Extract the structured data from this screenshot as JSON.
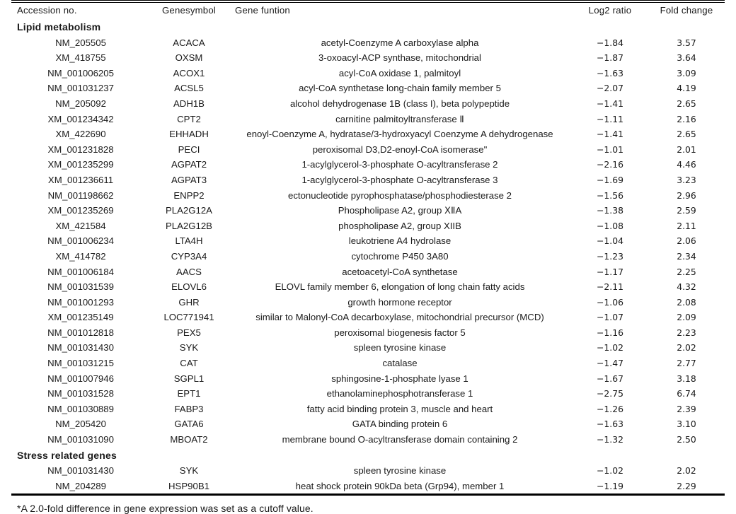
{
  "table": {
    "columns": [
      {
        "key": "accession",
        "label": "Accession no."
      },
      {
        "key": "genesymbol",
        "label": "Genesymbol"
      },
      {
        "key": "function",
        "label": "Gene funtion"
      },
      {
        "key": "log2",
        "label": "Log2 ratio"
      },
      {
        "key": "fold",
        "label": "Fold change"
      }
    ],
    "sections": [
      {
        "title": "Lipid metabolism",
        "rows": [
          {
            "accession": "NM_205505",
            "genesymbol": "ACACA",
            "function": "acetyl-Coenzyme  A carboxylase alpha",
            "log2": "−1.84",
            "fold": "3.57"
          },
          {
            "accession": "XM_418755",
            "genesymbol": "OXSM",
            "function": "3-oxoacyl-ACP  synthase, mitochondrial",
            "log2": "−1.87",
            "fold": "3.64"
          },
          {
            "accession": "NM_001006205",
            "genesymbol": "ACOX1",
            "function": "acyl-CoA  oxidase 1, palmitoyl",
            "log2": "−1.63",
            "fold": "3.09"
          },
          {
            "accession": "NM_001031237",
            "genesymbol": "ACSL5",
            "function": "acyl-CoA  synthetase long-chain family member 5",
            "log2": "−2.07",
            "fold": "4.19"
          },
          {
            "accession": "NM_205092",
            "genesymbol": "ADH1B",
            "function": "alcohol  dehydrogenase 1B (class I), beta polypeptide",
            "log2": "−1.41",
            "fold": "2.65"
          },
          {
            "accession": "XM_001234342",
            "genesymbol": "CPT2",
            "function": "carnitine  palmitoyltransferase Ⅱ",
            "log2": "−1.11",
            "fold": "2.16"
          },
          {
            "accession": "XM_422690",
            "genesymbol": "EHHADH",
            "function": "enoyl-Coenzyme  A, hydratase/3-hydroxyacyl Coenzyme A dehydrogenase",
            "log2": "−1.41",
            "fold": "2.65"
          },
          {
            "accession": "XM_001231828",
            "genesymbol": "PECI",
            "function": "peroxisomal  D3,D2-enoyl-CoA isomerase\"",
            "log2": "−1.01",
            "fold": "2.01"
          },
          {
            "accession": "XM_001235299",
            "genesymbol": "AGPAT2",
            "function": "1-acylglycerol-3-phosphate  O-acyltransferase 2",
            "log2": "−2.16",
            "fold": "4.46"
          },
          {
            "accession": "XM_001236611",
            "genesymbol": "AGPAT3",
            "function": "1-acylglycerol-3-phosphate  O-acyltransferase 3",
            "log2": "−1.69",
            "fold": "3.23"
          },
          {
            "accession": "NM_001198662",
            "genesymbol": "ENPP2",
            "function": "ectonucleotide  pyrophosphatase/phosphodiesterase 2",
            "log2": "−1.56",
            "fold": "2.96"
          },
          {
            "accession": "XM_001235269",
            "genesymbol": "PLA2G12A",
            "function": "Phospholipase  A2, group ⅩⅡA",
            "log2": "−1.38",
            "fold": "2.59"
          },
          {
            "accession": "XM_421584",
            "genesymbol": "PLA2G12B",
            "function": "phospholipase  A2, group XIIB",
            "log2": "−1.08",
            "fold": "2.11"
          },
          {
            "accession": "NM_001006234",
            "genesymbol": "LTA4H",
            "function": "leukotriene  A4 hydrolase",
            "log2": "−1.04",
            "fold": "2.06"
          },
          {
            "accession": "XM_414782",
            "genesymbol": "CYP3A4",
            "function": "cytochrome  P450 3A80",
            "log2": "−1.23",
            "fold": "2.34"
          },
          {
            "accession": "NM_001006184",
            "genesymbol": "AACS",
            "function": "acetoacetyl-CoA  synthetase",
            "log2": "−1.17",
            "fold": "2.25"
          },
          {
            "accession": "NM_001031539",
            "genesymbol": "ELOVL6",
            "function": "ELOVL  family member 6, elongation of long chain fatty acids",
            "log2": "−2.11",
            "fold": "4.32"
          },
          {
            "accession": "NM_001001293",
            "genesymbol": "GHR",
            "function": "growth hormone  receptor",
            "log2": "−1.06",
            "fold": "2.08"
          },
          {
            "accession": "XM_001235149",
            "genesymbol": "LOC771941",
            "function": "similar  to Malonyl-CoA decarboxylase, mitochondrial precursor (MCD)",
            "log2": "−1.07",
            "fold": "2.09"
          },
          {
            "accession": "NM_001012818",
            "genesymbol": "PEX5",
            "function": "peroxisomal  biogenesis factor 5",
            "log2": "−1.16",
            "fold": "2.23"
          },
          {
            "accession": "NM_001031430",
            "genesymbol": "SYK",
            "function": "spleen  tyrosine kinase",
            "log2": "−1.02",
            "fold": "2.02"
          },
          {
            "accession": "NM_001031215",
            "genesymbol": "CAT",
            "function": "catalase",
            "log2": "−1.47",
            "fold": "2.77"
          },
          {
            "accession": "NM_001007946",
            "genesymbol": "SGPL1",
            "function": "sphingosine-1-phosphate  lyase 1",
            "log2": "−1.67",
            "fold": "3.18"
          },
          {
            "accession": "NM_001031528",
            "genesymbol": "EPT1",
            "function": "ethanolaminephosphotransferase  1",
            "log2": "−2.75",
            "fold": "6.74"
          },
          {
            "accession": "NM_001030889",
            "genesymbol": "FABP3",
            "function": "fatty  acid binding protein 3, muscle and heart",
            "log2": "−1.26",
            "fold": "2.39"
          },
          {
            "accession": "NM_205420",
            "genesymbol": "GATA6",
            "function": "GATA binding  protein 6",
            "log2": "−1.63",
            "fold": "3.10"
          },
          {
            "accession": "NM_001031090",
            "genesymbol": "MBOAT2",
            "function": "membrane bound  O-acyltransferase domain containing 2",
            "log2": "−1.32",
            "fold": "2.50"
          }
        ]
      },
      {
        "title": "Stress related genes",
        "rows": [
          {
            "accession": "NM_001031430",
            "genesymbol": "SYK",
            "function": "spleen  tyrosine kinase",
            "log2": "−1.02",
            "fold": "2.02"
          },
          {
            "accession": "NM_204289",
            "genesymbol": "HSP90B1",
            "function": "heat  shock protein 90kDa beta (Grp94), member 1",
            "log2": "−1.19",
            "fold": "2.29"
          }
        ]
      }
    ]
  },
  "footnote": {
    "marker": "*",
    "text": "A 2.0-fold  difference  in  gene  expression  was  set  as  a  cutoff  value."
  }
}
